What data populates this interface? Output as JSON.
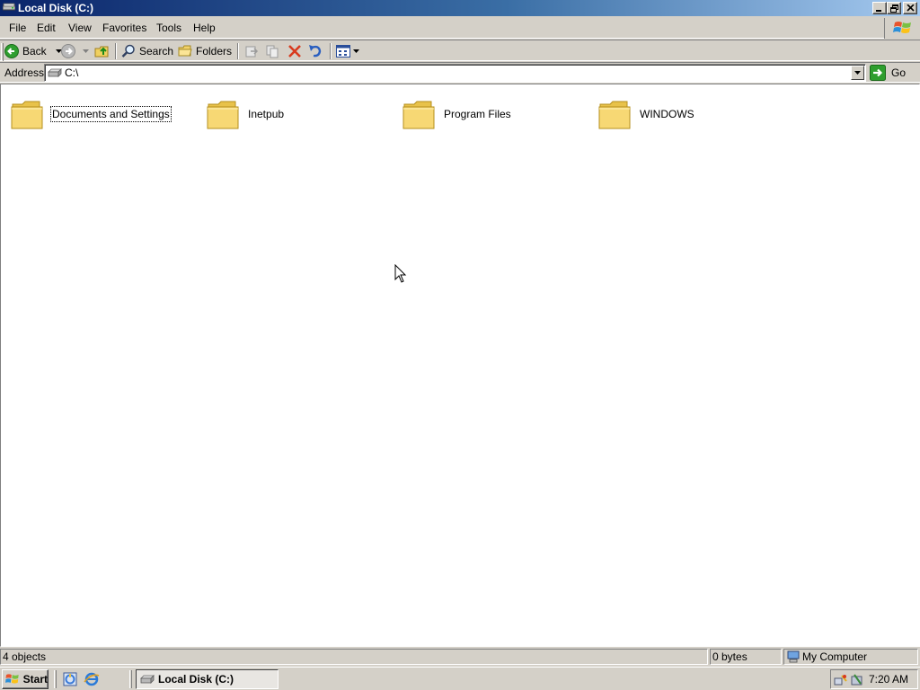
{
  "window": {
    "title": "Local Disk (C:)"
  },
  "menu": {
    "items": [
      "File",
      "Edit",
      "View",
      "Favorites",
      "Tools",
      "Help"
    ]
  },
  "toolbar": {
    "back_label": "Back",
    "search_label": "Search",
    "folders_label": "Folders"
  },
  "address": {
    "label": "Address",
    "value": "C:\\",
    "go_label": "Go"
  },
  "folders": [
    {
      "name": "Documents and Settings",
      "selected": true
    },
    {
      "name": "Inetpub",
      "selected": false
    },
    {
      "name": "Program Files",
      "selected": false
    },
    {
      "name": "WINDOWS",
      "selected": false
    }
  ],
  "status": {
    "objects": "4 objects",
    "size": "0 bytes",
    "location": "My Computer"
  },
  "taskbar": {
    "start_label": "Start",
    "task_label": "Local Disk (C:)",
    "clock": "7:20 AM"
  },
  "colors": {
    "title_gradient_start": "#0a246a",
    "title_gradient_end": "#a6caf0",
    "chrome": "#d4d0c8",
    "folder_yellow": "#f7d874"
  }
}
